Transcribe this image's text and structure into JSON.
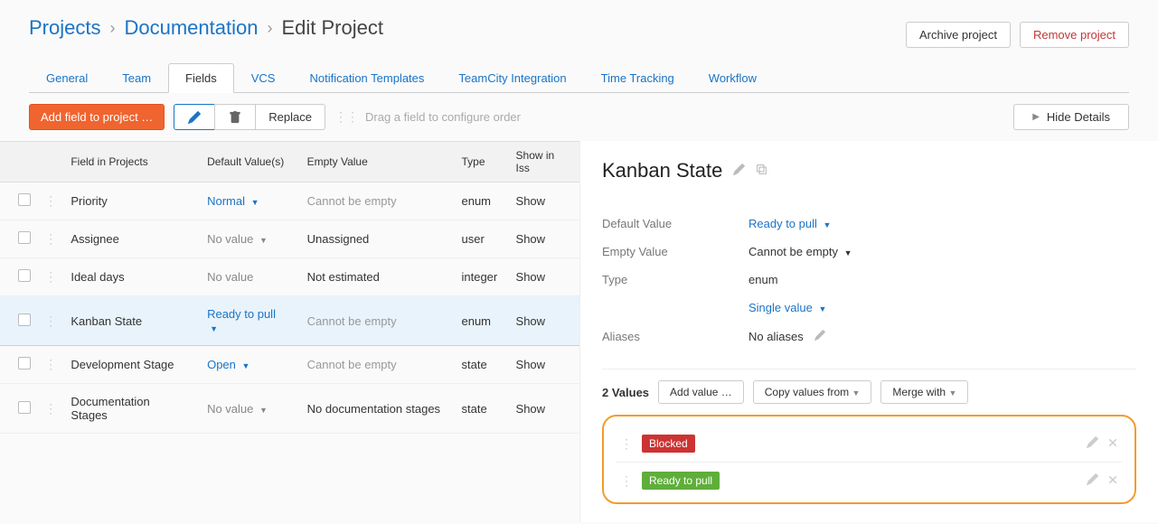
{
  "breadcrumb": {
    "projects": "Projects",
    "project_name": "Documentation",
    "current": "Edit Project"
  },
  "header_actions": {
    "archive": "Archive project",
    "remove": "Remove project"
  },
  "tabs": [
    {
      "label": "General",
      "active": false
    },
    {
      "label": "Team",
      "active": false
    },
    {
      "label": "Fields",
      "active": true
    },
    {
      "label": "VCS",
      "active": false
    },
    {
      "label": "Notification Templates",
      "active": false
    },
    {
      "label": "TeamCity Integration",
      "active": false
    },
    {
      "label": "Time Tracking",
      "active": false
    },
    {
      "label": "Workflow",
      "active": false
    }
  ],
  "toolbar": {
    "add_field": "Add field to project …",
    "replace": "Replace",
    "hint": "Drag a field to configure order",
    "hide_details": "Hide Details"
  },
  "columns": {
    "field": "Field in Projects",
    "default": "Default Value(s)",
    "empty": "Empty Value",
    "type": "Type",
    "show": "Show in Iss"
  },
  "rows": [
    {
      "name": "Priority",
      "default": "Normal",
      "default_muted": false,
      "empty": "Cannot be empty",
      "empty_gray": true,
      "type": "enum",
      "show": "Show",
      "selected": false
    },
    {
      "name": "Assignee",
      "default": "No value",
      "default_muted": true,
      "empty": "Unassigned",
      "empty_gray": false,
      "type": "user",
      "show": "Show",
      "selected": false
    },
    {
      "name": "Ideal days",
      "default": "No value",
      "default_muted": true,
      "no_caret": true,
      "empty": "Not estimated",
      "empty_gray": false,
      "type": "integer",
      "show": "Show",
      "selected": false
    },
    {
      "name": "Kanban State",
      "default": "Ready to pull",
      "default_muted": false,
      "empty": "Cannot be empty",
      "empty_gray": true,
      "type": "enum",
      "show": "Show",
      "selected": true
    },
    {
      "name": "Development Stage",
      "default": "Open",
      "default_muted": false,
      "empty": "Cannot be empty",
      "empty_gray": true,
      "type": "state",
      "show": "Show",
      "selected": false
    },
    {
      "name": "Documentation Stages",
      "default": "No value",
      "default_muted": true,
      "empty": "No documentation stages",
      "empty_gray": false,
      "type": "state",
      "show": "Show",
      "selected": false
    }
  ],
  "detail": {
    "title": "Kanban State",
    "default_label": "Default Value",
    "default_value": "Ready to pull",
    "empty_label": "Empty Value",
    "empty_value": "Cannot be empty",
    "type_label": "Type",
    "type_value": "enum",
    "type_variant": "Single value",
    "aliases_label": "Aliases",
    "aliases_value": "No aliases",
    "values_count": "2 Values",
    "add_value": "Add value …",
    "copy_values": "Copy values from",
    "merge_with": "Merge with",
    "values": [
      {
        "label": "Blocked",
        "color": "tag-red"
      },
      {
        "label": "Ready to pull",
        "color": "tag-green"
      }
    ]
  }
}
